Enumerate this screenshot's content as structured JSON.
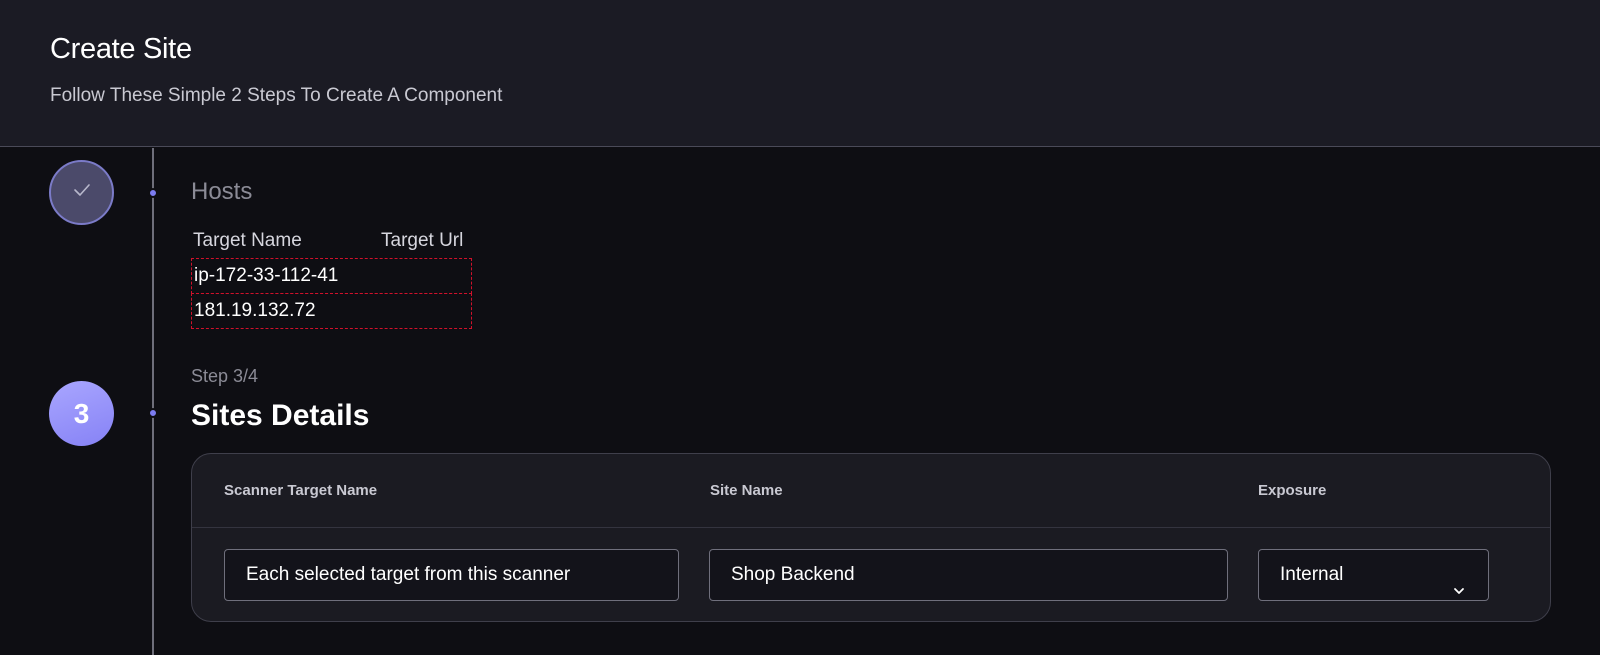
{
  "header": {
    "title": "Create Site",
    "subtitle": "Follow These Simple 2 Steps To Create A Component"
  },
  "hosts": {
    "title": "Hosts",
    "columns": [
      "Target Name",
      "Target Url"
    ],
    "rows": [
      "ip-172-33-112-41",
      "181.19.132.72"
    ],
    "icon": "check-icon"
  },
  "step": {
    "number": "3",
    "label": "Step 3/4",
    "title": "Sites Details"
  },
  "site_details": {
    "labels": {
      "scanner_target_name": "Scanner Target Name",
      "site_name": "Site Name",
      "exposure": "Exposure"
    },
    "values": {
      "scanner_target_name": "Each selected target from this scanner",
      "site_name": "Shop Backend",
      "exposure": "Internal"
    },
    "exposure_icon": "chevron-down-icon"
  },
  "colors": {
    "accent": "#8682f5",
    "background": "#0e0e13",
    "header_bg": "#1b1b24",
    "dashed_outline": "#d0112b"
  }
}
